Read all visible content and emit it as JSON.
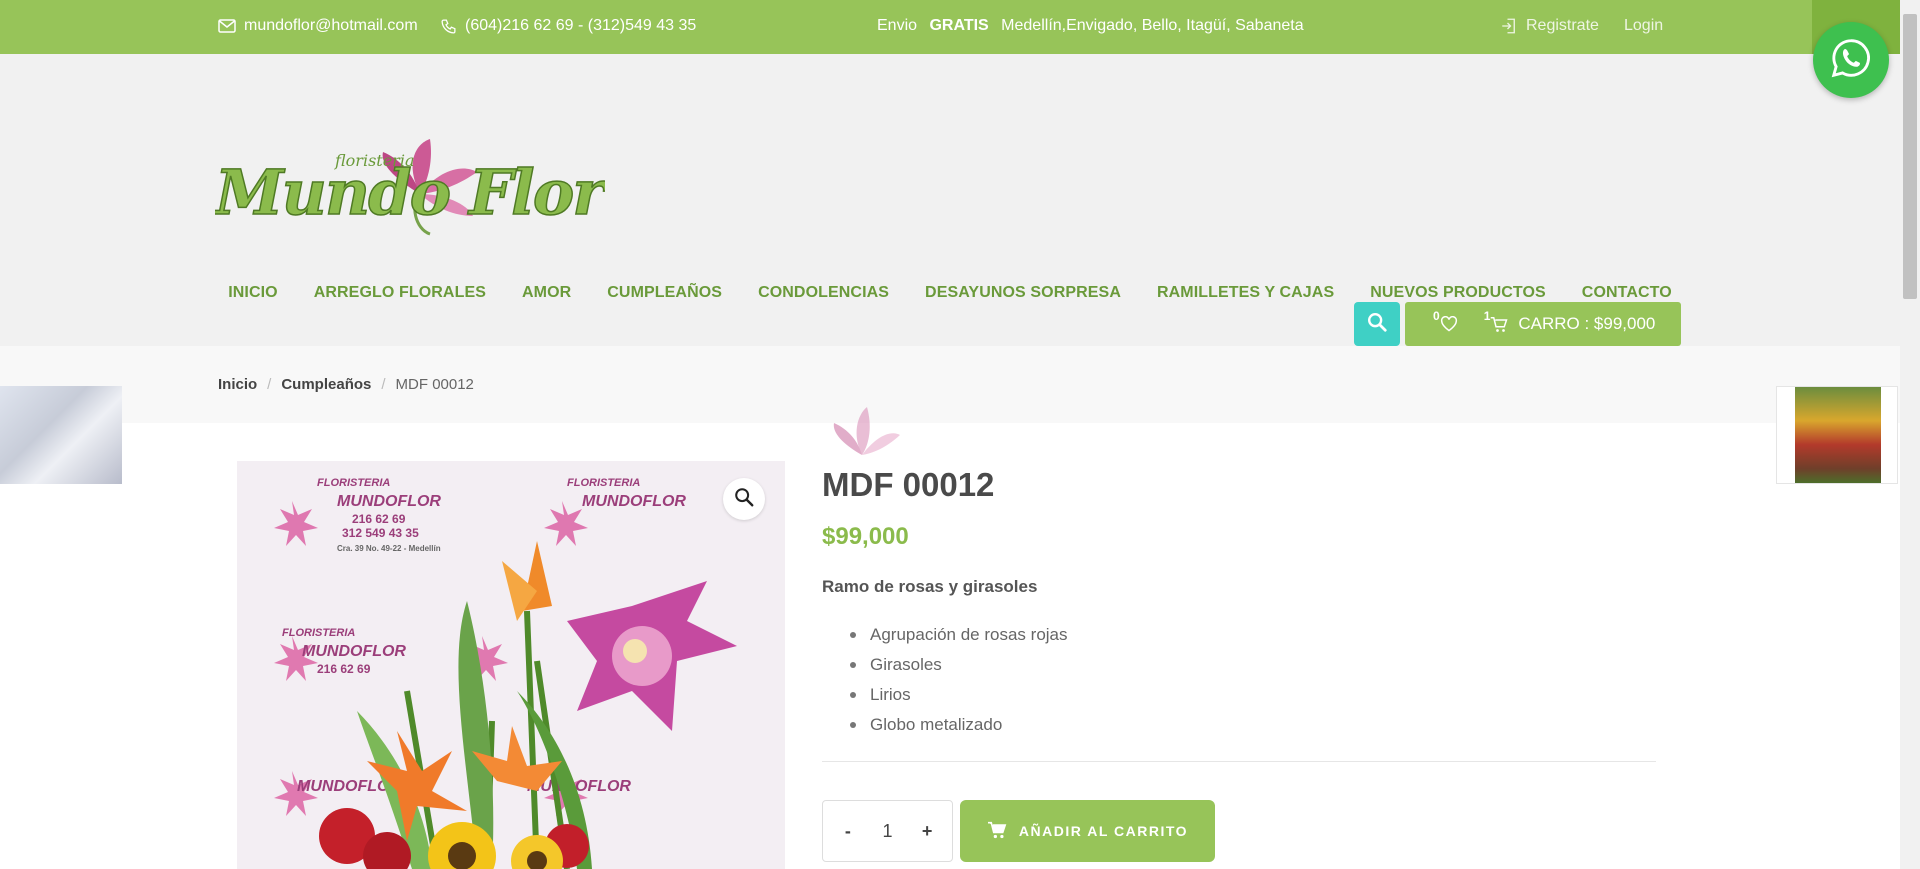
{
  "topbar": {
    "email": "mundoflor@hotmail.com",
    "phone": "(604)216 62 69 - (312)549 43 35",
    "shipping_prefix": "Envio ",
    "shipping_bold": "GRATIS",
    "shipping_suffix": " Medellín,Envigado, Bello, Itagüí, Sabaneta",
    "register": "Registrate",
    "login": "Login"
  },
  "logo": {
    "small_text": "floristeria",
    "brand_text": "Mundo Flor"
  },
  "nav": {
    "items": [
      "INICIO",
      "ARREGLO FLORALES",
      "AMOR",
      "CUMPLEAÑOS",
      "CONDOLENCIAS",
      "DESAYUNOS SORPRESA",
      "RAMILLETES Y CAJAS",
      "NUEVOS PRODUCTOS",
      "CONTACTO"
    ]
  },
  "cart": {
    "wishlist_count": "0",
    "cart_count": "1",
    "label": "CARRO : $99,000"
  },
  "breadcrumb": {
    "home": "Inicio",
    "sep": "/",
    "category": "Cumpleaños",
    "current": "MDF 00012"
  },
  "product": {
    "title": "MDF 00012",
    "price": "$99,000",
    "subtitle": "Ramo de rosas y girasoles",
    "features": [
      "Agrupación de rosas rojas",
      "Girasoles",
      "Lirios",
      "Globo metalizado"
    ],
    "qty_minus": "-",
    "qty_value": "1",
    "qty_plus": "+",
    "add_to_cart": "AÑADIR AL CARRITO"
  },
  "image_watermark": {
    "brand": "FLORISTERIA",
    "name": "MUNDOFLOR",
    "phone1": "216 62 69",
    "phone2": "312 549 43 35",
    "address": "Cra. 39 No. 49-22 - Medellín"
  },
  "colors": {
    "primary_green": "#97c459",
    "nav_green": "#6a9a3a",
    "search_teal": "#3fd0c5",
    "whatsapp": "#3ec04f"
  },
  "icons": [
    "envelope-icon",
    "phone-icon",
    "login-icon",
    "search-icon",
    "heart-icon",
    "cart-icon",
    "zoom-icon",
    "whatsapp-icon"
  ]
}
